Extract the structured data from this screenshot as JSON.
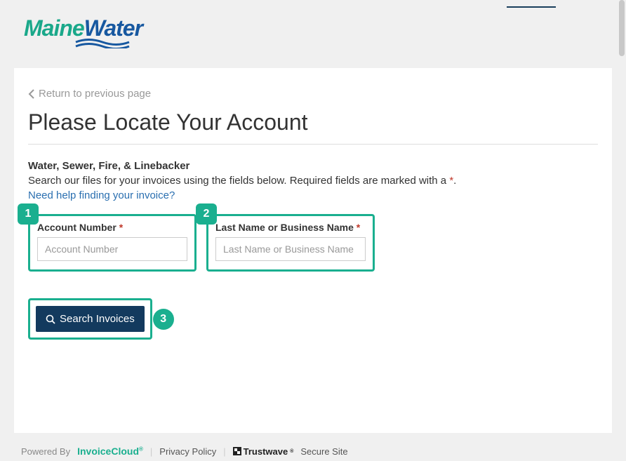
{
  "header": {
    "logo_part1": "Maine",
    "logo_part2": "Water"
  },
  "main": {
    "return_link": "Return to previous page",
    "title": "Please Locate Your Account",
    "subhead": "Water, Sewer, Fire, & Linebacker",
    "description_pre": "Search our files for your invoices using the fields below.  Required fields are marked with a ",
    "description_post": ".",
    "required_marker": "*",
    "help_link": "Need help finding your invoice?",
    "fields": {
      "account": {
        "badge": "1",
        "label": "Account Number ",
        "placeholder": "Account Number"
      },
      "name": {
        "badge": "2",
        "label": "Last Name or Business Name ",
        "placeholder": "Last Name or Business Name"
      }
    },
    "button": {
      "badge": "3",
      "label": "Search Invoices"
    }
  },
  "footer": {
    "powered_by": "Powered By",
    "invoicecloud": "InvoiceCloud",
    "privacy": "Privacy Policy",
    "trustwave": "Trustwave",
    "secure": "Secure Site"
  }
}
